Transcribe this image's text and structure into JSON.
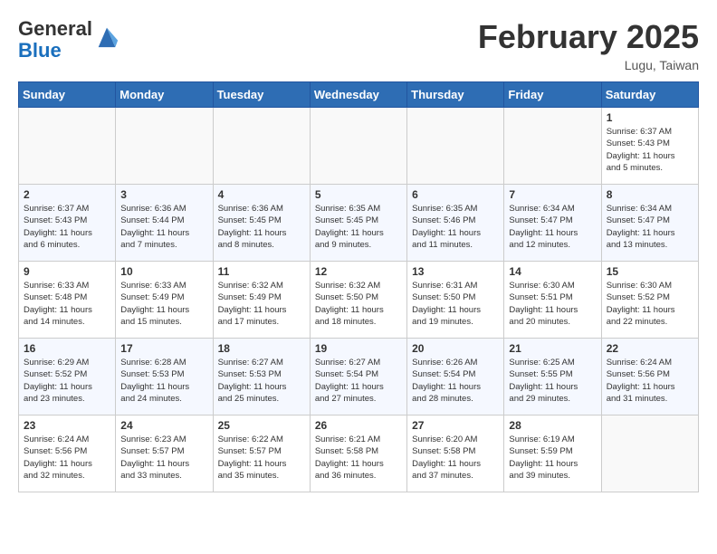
{
  "header": {
    "logo_general": "General",
    "logo_blue": "Blue",
    "month_title": "February 2025",
    "location": "Lugu, Taiwan"
  },
  "weekdays": [
    "Sunday",
    "Monday",
    "Tuesday",
    "Wednesday",
    "Thursday",
    "Friday",
    "Saturday"
  ],
  "weeks": [
    [
      {
        "day": "",
        "info": ""
      },
      {
        "day": "",
        "info": ""
      },
      {
        "day": "",
        "info": ""
      },
      {
        "day": "",
        "info": ""
      },
      {
        "day": "",
        "info": ""
      },
      {
        "day": "",
        "info": ""
      },
      {
        "day": "1",
        "info": "Sunrise: 6:37 AM\nSunset: 5:43 PM\nDaylight: 11 hours\nand 5 minutes."
      }
    ],
    [
      {
        "day": "2",
        "info": "Sunrise: 6:37 AM\nSunset: 5:43 PM\nDaylight: 11 hours\nand 6 minutes."
      },
      {
        "day": "3",
        "info": "Sunrise: 6:36 AM\nSunset: 5:44 PM\nDaylight: 11 hours\nand 7 minutes."
      },
      {
        "day": "4",
        "info": "Sunrise: 6:36 AM\nSunset: 5:45 PM\nDaylight: 11 hours\nand 8 minutes."
      },
      {
        "day": "5",
        "info": "Sunrise: 6:35 AM\nSunset: 5:45 PM\nDaylight: 11 hours\nand 9 minutes."
      },
      {
        "day": "6",
        "info": "Sunrise: 6:35 AM\nSunset: 5:46 PM\nDaylight: 11 hours\nand 11 minutes."
      },
      {
        "day": "7",
        "info": "Sunrise: 6:34 AM\nSunset: 5:47 PM\nDaylight: 11 hours\nand 12 minutes."
      },
      {
        "day": "8",
        "info": "Sunrise: 6:34 AM\nSunset: 5:47 PM\nDaylight: 11 hours\nand 13 minutes."
      }
    ],
    [
      {
        "day": "9",
        "info": "Sunrise: 6:33 AM\nSunset: 5:48 PM\nDaylight: 11 hours\nand 14 minutes."
      },
      {
        "day": "10",
        "info": "Sunrise: 6:33 AM\nSunset: 5:49 PM\nDaylight: 11 hours\nand 15 minutes."
      },
      {
        "day": "11",
        "info": "Sunrise: 6:32 AM\nSunset: 5:49 PM\nDaylight: 11 hours\nand 17 minutes."
      },
      {
        "day": "12",
        "info": "Sunrise: 6:32 AM\nSunset: 5:50 PM\nDaylight: 11 hours\nand 18 minutes."
      },
      {
        "day": "13",
        "info": "Sunrise: 6:31 AM\nSunset: 5:50 PM\nDaylight: 11 hours\nand 19 minutes."
      },
      {
        "day": "14",
        "info": "Sunrise: 6:30 AM\nSunset: 5:51 PM\nDaylight: 11 hours\nand 20 minutes."
      },
      {
        "day": "15",
        "info": "Sunrise: 6:30 AM\nSunset: 5:52 PM\nDaylight: 11 hours\nand 22 minutes."
      }
    ],
    [
      {
        "day": "16",
        "info": "Sunrise: 6:29 AM\nSunset: 5:52 PM\nDaylight: 11 hours\nand 23 minutes."
      },
      {
        "day": "17",
        "info": "Sunrise: 6:28 AM\nSunset: 5:53 PM\nDaylight: 11 hours\nand 24 minutes."
      },
      {
        "day": "18",
        "info": "Sunrise: 6:27 AM\nSunset: 5:53 PM\nDaylight: 11 hours\nand 25 minutes."
      },
      {
        "day": "19",
        "info": "Sunrise: 6:27 AM\nSunset: 5:54 PM\nDaylight: 11 hours\nand 27 minutes."
      },
      {
        "day": "20",
        "info": "Sunrise: 6:26 AM\nSunset: 5:54 PM\nDaylight: 11 hours\nand 28 minutes."
      },
      {
        "day": "21",
        "info": "Sunrise: 6:25 AM\nSunset: 5:55 PM\nDaylight: 11 hours\nand 29 minutes."
      },
      {
        "day": "22",
        "info": "Sunrise: 6:24 AM\nSunset: 5:56 PM\nDaylight: 11 hours\nand 31 minutes."
      }
    ],
    [
      {
        "day": "23",
        "info": "Sunrise: 6:24 AM\nSunset: 5:56 PM\nDaylight: 11 hours\nand 32 minutes."
      },
      {
        "day": "24",
        "info": "Sunrise: 6:23 AM\nSunset: 5:57 PM\nDaylight: 11 hours\nand 33 minutes."
      },
      {
        "day": "25",
        "info": "Sunrise: 6:22 AM\nSunset: 5:57 PM\nDaylight: 11 hours\nand 35 minutes."
      },
      {
        "day": "26",
        "info": "Sunrise: 6:21 AM\nSunset: 5:58 PM\nDaylight: 11 hours\nand 36 minutes."
      },
      {
        "day": "27",
        "info": "Sunrise: 6:20 AM\nSunset: 5:58 PM\nDaylight: 11 hours\nand 37 minutes."
      },
      {
        "day": "28",
        "info": "Sunrise: 6:19 AM\nSunset: 5:59 PM\nDaylight: 11 hours\nand 39 minutes."
      },
      {
        "day": "",
        "info": ""
      }
    ]
  ]
}
